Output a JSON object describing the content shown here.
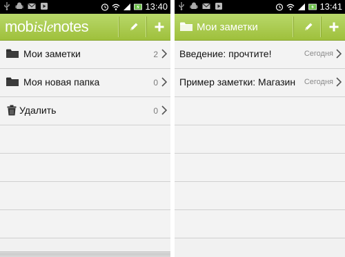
{
  "left_screen": {
    "status": {
      "time": "13:40"
    },
    "appbar": {
      "logo_part1": "mob",
      "logo_part2": "isle",
      "logo_part3": "notes"
    },
    "folders": [
      {
        "label": "Мои заметки",
        "count": "2",
        "icon": "folder-icon"
      },
      {
        "label": "Моя новая папка",
        "count": "0",
        "icon": "folder-icon"
      },
      {
        "label": "Удалить",
        "count": "0",
        "icon": "trash-icon"
      }
    ]
  },
  "right_screen": {
    "status": {
      "time": "13:41"
    },
    "appbar": {
      "title": "Мои заметки"
    },
    "notes": [
      {
        "title": "Введение: прочтите!",
        "date": "Сегодня"
      },
      {
        "title": "Пример заметки: Магазин",
        "date": "Сегодня"
      }
    ]
  },
  "colors": {
    "appbar_green": "#a6c64a",
    "statusbar": "#000000",
    "list_bg": "#f3f3f3",
    "divider": "#d0d0d0"
  }
}
